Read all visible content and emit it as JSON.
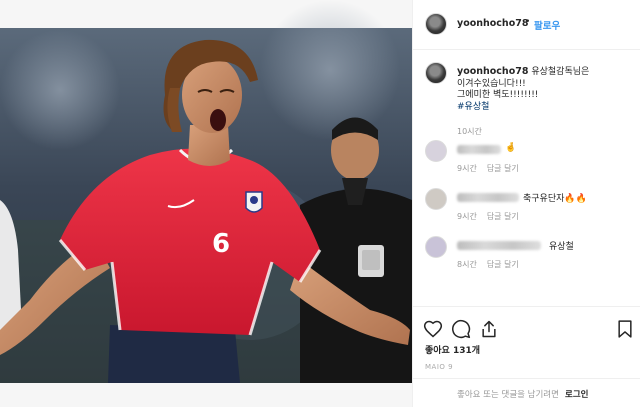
{
  "post": {
    "username": "yoonhocho78",
    "follow_separator": "•",
    "follow_label": "팔로우"
  },
  "caption": {
    "username": "yoonhocho78",
    "lines": [
      "유상철감독님은",
      "이겨수있습니다!!!",
      "그에미한 벽도!!!!!!!!"
    ],
    "hashtag": "#유상철",
    "time": "10시간"
  },
  "comments": [
    {
      "text": "🤞",
      "time": "9시간",
      "reply": "답글 달기"
    },
    {
      "text": "축구유단자🔥🔥",
      "time": "9시간",
      "reply": "답글 달기"
    },
    {
      "text": "유상철",
      "time": "8시간",
      "reply": "답글 달기"
    }
  ],
  "actions": {
    "icons": [
      "heart-icon",
      "comment-icon",
      "share-icon",
      "bookmark-icon"
    ],
    "likes": "좋아요 131개",
    "date": "MAIO 9"
  },
  "footer": {
    "prompt": "좋아요 또는 댓글을 남기려면",
    "login": "로그인"
  },
  "photo": {
    "jersey_number": "6",
    "colors": {
      "jersey": "#e2263c",
      "shorts": "#1f2a44",
      "referee": "#111111",
      "background": "#2e3a4a"
    }
  }
}
